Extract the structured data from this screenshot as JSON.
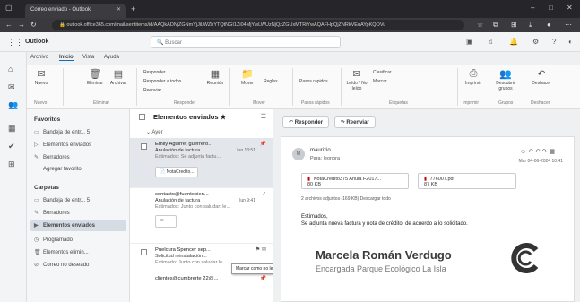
{
  "browser": {
    "tab_title": "Correo enviado - Outlook",
    "url": "outlook.office365.com/mail/sentitems/id/AAQkADNjZGNmYjJiLWZhYTQtNGI1Zi04MjYwLWUzNjQzZGUxMTRiYwAQAFHpQjZNRkVEuAYpKQOVu",
    "new_tab": "+",
    "window_controls": [
      "–",
      "□",
      "✕"
    ]
  },
  "app": {
    "name": "Outlook",
    "search_placeholder": "Buscar"
  },
  "ribbon": {
    "tabs": [
      "Archivo",
      "Inicio",
      "Vista",
      "Ayuda"
    ],
    "buttons": {
      "nuevo": "Nuevo",
      "eliminar": "Eliminar",
      "archivar": "Archivar",
      "responder": "Responder",
      "responder_todos": "Responder a todos",
      "reenviar": "Reenviar",
      "reunion": "Reunión",
      "mover": "Mover",
      "reglas": "Reglas",
      "pasos_rapidos": "Pasos rápidos",
      "leido_no_leido": "Leído / No leído",
      "clasificar": "Clasificar",
      "marcar": "Marcar",
      "imprimir": "Imprimir",
      "descubrir": "Descubrir grupos",
      "deshacer": "Deshacer"
    },
    "groups": [
      "Nuevo",
      "Eliminar",
      "Responder",
      "Mover",
      "Pasos rápidos",
      "Etiquetas",
      "Imprimir",
      "Grupos",
      "Deshacer"
    ]
  },
  "folders": {
    "favorites_header": "Favoritos",
    "favorites": [
      {
        "label": "Bandeja de entr...",
        "count": "5"
      },
      {
        "label": "Elementos enviados",
        "count": ""
      },
      {
        "label": "Borradores",
        "count": ""
      },
      {
        "label": "Agregar favorito",
        "count": ""
      }
    ],
    "folders_header": "Carpetas",
    "folders": [
      {
        "label": "Bandeja de entr...",
        "count": "5"
      },
      {
        "label": "Borradores",
        "count": ""
      },
      {
        "label": "Elementos enviados",
        "count": ""
      },
      {
        "label": "Programado",
        "count": ""
      },
      {
        "label": "Elementos elimin...",
        "count": ""
      },
      {
        "label": "Correo no deseado",
        "count": ""
      }
    ]
  },
  "message_list": {
    "title": "Elementos enviados",
    "star": "★",
    "group_label": "Ayer",
    "items": [
      {
        "from": "Emily Aguirre; guerrero...",
        "subject": "Anulación de factura",
        "preview": "Estimados: Se adjunta factu...",
        "date": "lun 13:51",
        "attachment": "NotaCredito..."
      },
      {
        "from": "contacto@fuentebien...",
        "subject": "Anulación de factura",
        "preview": "Estimados: Junto con saludar: le...",
        "date": "lun 9:41",
        "attachment": ""
      },
      {
        "from": "Puelcura Spencer sep...",
        "subject": "Solicitud reinstalación...",
        "preview": "Estimado: Junto con saludar le...",
        "date": "",
        "attachment": ""
      },
      {
        "from": "clientes@cumbrerte 22@...",
        "subject": "",
        "preview": "",
        "date": "",
        "attachment": ""
      }
    ],
    "tooltip": "Marcar como no leído"
  },
  "reading": {
    "reply": "Responder",
    "forward": "Reenviar",
    "sender": "maurizio",
    "to": "Para: leonora",
    "date": "Mar 04-06-2024 10:41",
    "attachments": [
      {
        "name": "NotaCredito375 Anula F2017...",
        "size": "80 KB"
      },
      {
        "name": "776007.pdf",
        "size": "87 KB"
      }
    ],
    "download": "2 archivos adjuntos (169 KB)   Descargar todo",
    "greeting": "Estimados,",
    "body": "Se adjunta nueva factura y nota de crédito, de acuerdo a lo solicitado.",
    "signature_name": "Marcela Román Verdugo",
    "signature_role": "Encargada Parque Ecológico La Isla"
  }
}
